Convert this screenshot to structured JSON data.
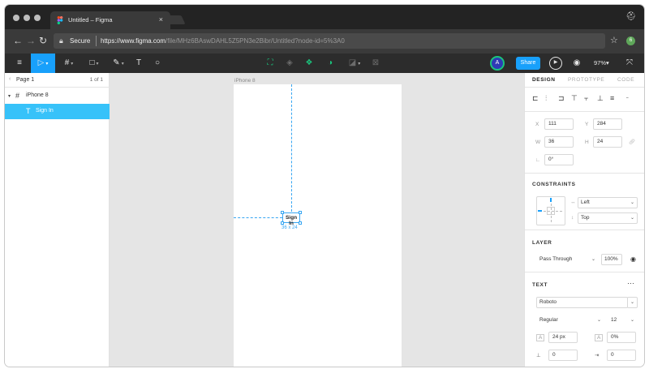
{
  "browser": {
    "tab_title": "Untitled – Figma",
    "tab_close": "×",
    "secure_label": "Secure",
    "url_host": "https://www.figma.com",
    "url_path": "/file/MHz6BAswDAHL5Z5PN3e2Bibr/Untitled?node-id=5%3A0",
    "extension_badge": "6",
    "incognito_icon": "⛑"
  },
  "toolbar": {
    "menu_icon": "≡",
    "move_icon": "▷",
    "frame_icon": "#",
    "shape_icon": "□",
    "pen_icon": "✎",
    "text_icon": "T",
    "comment_icon": "○",
    "avatar_initial": "A",
    "share_label": "Share",
    "zoom_label": "97%",
    "accent_color": "#18a0fb",
    "component_color": "#1bc47d"
  },
  "layers": {
    "page_name": "Page 1",
    "page_count": "1 of 1",
    "items": [
      {
        "name": "iPhone 8",
        "icon": "#"
      },
      {
        "name": "Sign In",
        "icon": "T"
      }
    ]
  },
  "canvas": {
    "frame_label": "iPhone 8",
    "selected_text": "Sign In",
    "selection_size": "36 x 24"
  },
  "design": {
    "tabs": [
      "DESIGN",
      "PROTOTYPE",
      "CODE"
    ],
    "x_label": "X",
    "x": "111",
    "y_label": "Y",
    "y": "284",
    "w_label": "W",
    "w": "36",
    "h_label": "H",
    "h": "24",
    "rotation": "0°",
    "constraints_title": "CONSTRAINTS",
    "constraint_h": "Left",
    "constraint_v": "Top",
    "layer_title": "LAYER",
    "blend_mode": "Pass Through",
    "opacity": "100%",
    "text_title": "TEXT",
    "font_family": "Roboto",
    "font_style": "Regular",
    "font_size": "12",
    "line_height": "24 px",
    "letter_spacing": "0%",
    "paragraph_spacing": "0",
    "paragraph_indent": "0"
  }
}
